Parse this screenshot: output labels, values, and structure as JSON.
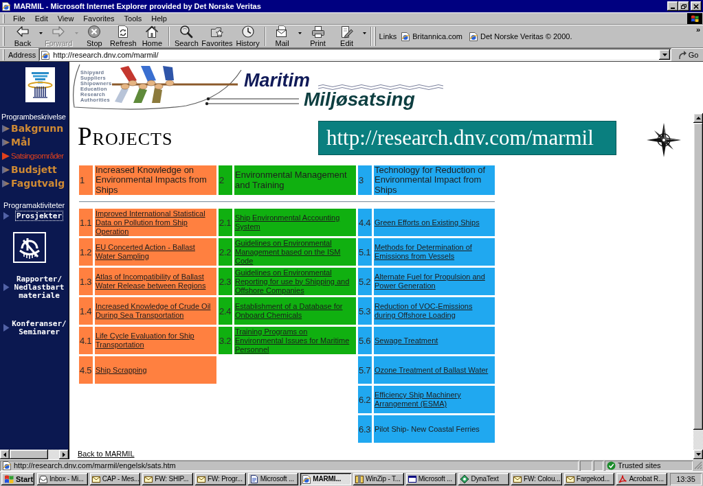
{
  "window": {
    "title": "MARMIL - Microsoft Internet Explorer provided by Det Norske Veritas"
  },
  "menu": [
    "File",
    "Edit",
    "View",
    "Favorites",
    "Tools",
    "Help"
  ],
  "toolbar": {
    "groups": [
      {
        "buttons": [
          {
            "kind": "back",
            "label": "Back",
            "disabled": false,
            "dropdown": true
          },
          {
            "kind": "forward",
            "label": "Forward",
            "disabled": true,
            "dropdown": true
          },
          {
            "kind": "stop",
            "label": "Stop",
            "disabled": false,
            "dropdown": false
          },
          {
            "kind": "refresh",
            "label": "Refresh",
            "disabled": false,
            "dropdown": false
          },
          {
            "kind": "home",
            "label": "Home",
            "disabled": false,
            "dropdown": false
          }
        ]
      },
      {
        "buttons": [
          {
            "kind": "search",
            "label": "Search",
            "disabled": false,
            "dropdown": false
          },
          {
            "kind": "favorites",
            "label": "Favorites",
            "disabled": false,
            "dropdown": false
          },
          {
            "kind": "history",
            "label": "History",
            "disabled": false,
            "dropdown": false
          }
        ]
      },
      {
        "buttons": [
          {
            "kind": "mail",
            "label": "Mail",
            "disabled": false,
            "dropdown": true
          },
          {
            "kind": "print",
            "label": "Print",
            "disabled": false,
            "dropdown": false
          },
          {
            "kind": "edit",
            "label": "Edit",
            "disabled": false,
            "dropdown": true
          }
        ]
      }
    ]
  },
  "links_bar": {
    "label": "Links",
    "items": [
      "Britannica.com",
      "Det Norske Veritas © 2000."
    ],
    "more": "»"
  },
  "address_bar": {
    "label": "Address",
    "value": "http://research.dnv.com/marmil/",
    "go": "Go"
  },
  "sidebar": {
    "description": {
      "heading": "Programbeskrivelse",
      "items": [
        {
          "label": "Bakgrunn",
          "selected": false
        },
        {
          "label": "Mål",
          "selected": false
        },
        {
          "label": "Satsingsområder",
          "selected": true
        },
        {
          "label": "Budsjett",
          "selected": false
        },
        {
          "label": "Fagutvalg",
          "selected": false
        }
      ]
    },
    "activities": {
      "heading": "Programaktiviteter",
      "items": [
        {
          "label": "Prosjekter",
          "focused": true
        },
        {
          "label": "Rapporter/ Nedlastbart materiale",
          "focused": false
        },
        {
          "label": "Konferanser/ Seminarer",
          "focused": false
        }
      ]
    }
  },
  "banner": {
    "stakeholders": [
      "Shipyard",
      "Suppliers",
      "Shipowners",
      "Education",
      "Research",
      "Authorities"
    ],
    "title": "Maritim",
    "subtitle": "Miljøsatsing"
  },
  "main": {
    "heading": "PROJECTS",
    "url_banner": "http://research.dnv.com/marmil",
    "groups": [
      {
        "number": "1",
        "title": "Increased Knowledge on Environmental Impacts from Ships",
        "color": "#ff8040",
        "items": [
          {
            "number": "1.1",
            "title": "Improved International Statistical Data on Pollution from Ship Operation",
            "linked": true
          },
          {
            "number": "1.2",
            "title": "EU Concerted Action - Ballast Water Sampling",
            "linked": true
          },
          {
            "number": "1.3",
            "title": "Atlas of Incompatibility of Ballast Water Release between Regions",
            "linked": true
          },
          {
            "number": "1.4",
            "title": "Increased Knowledge of Crude Oil During Sea Transportation",
            "linked": true
          },
          {
            "number": "4.1",
            "title": "Life Cycle Evaluation for Ship Transportation",
            "linked": true
          },
          {
            "number": "4.5",
            "title": "Ship Scrapping",
            "linked": true
          }
        ]
      },
      {
        "number": "2",
        "title": "Environmental Management and Training",
        "color": "#10b010",
        "items": [
          {
            "number": "2.1",
            "title": "Ship Environmental Accounting System",
            "linked": true
          },
          {
            "number": "2.2",
            "title": "Guidelines on Environmental Management based on the ISM Code",
            "linked": true
          },
          {
            "number": "2.3",
            "title": "Guidelines on Environmental Reporting for use by Shipping and Offshore Companies",
            "linked": true
          },
          {
            "number": "2.4",
            "title": "Establishment of a Database for Onboard Chemicals",
            "linked": true
          },
          {
            "number": "3.2",
            "title": "Training Programs on Environmental Issues for Maritime Personnel",
            "linked": true
          }
        ]
      },
      {
        "number": "3",
        "title": "Technology for Reduction of Environmental Impact from Ships",
        "color": "#20a8f0",
        "items": [
          {
            "number": "4.4",
            "title": "Green Efforts on Existing Ships",
            "linked": true
          },
          {
            "number": "5.1",
            "title": "Methods for Determination of Emissions from Vessels",
            "linked": true
          },
          {
            "number": "5.2",
            "title": "Alternate Fuel for Propulsion and Power Generation",
            "linked": true
          },
          {
            "number": "5.3",
            "title": "Reduction of VOC-Emissions during Offshore Loading",
            "linked": true
          },
          {
            "number": "5.6",
            "title": "Sewage Treatment",
            "linked": true
          },
          {
            "number": "5.7",
            "title": "Ozone Treatment of Ballast Water",
            "linked": true
          },
          {
            "number": "6.2",
            "title": "Efficiency Ship Machinery Arrangement (ESMA)",
            "linked": true
          },
          {
            "number": "6.3",
            "title": "Pilot Ship- New Coastal Ferries",
            "linked": false
          }
        ]
      }
    ],
    "back_link": "Back to MARMIL"
  },
  "status_bar": {
    "text": "http://research.dnv.com/marmil/engelsk/sats.htm",
    "zone": "Trusted sites"
  },
  "taskbar": {
    "start": "Start",
    "tasks": [
      {
        "kind": "inbox",
        "label": "Inbox - Mi...",
        "selected": false
      },
      {
        "kind": "mail",
        "label": "CAP - Mes...",
        "selected": false
      },
      {
        "kind": "mail",
        "label": "FW: SHIP...",
        "selected": false
      },
      {
        "kind": "mail",
        "label": "FW: Progr...",
        "selected": false
      },
      {
        "kind": "document",
        "label": "Microsoft ...",
        "selected": false
      },
      {
        "kind": "browser",
        "label": "MARMI...",
        "selected": true
      },
      {
        "kind": "archive",
        "label": "WinZip - T...",
        "selected": false
      },
      {
        "kind": "window",
        "label": "Microsoft ...",
        "selected": false
      },
      {
        "kind": "diamond",
        "label": "DynaText",
        "selected": false
      },
      {
        "kind": "mail",
        "label": "FW: Colou...",
        "selected": false
      },
      {
        "kind": "mail",
        "label": "Fargekod...",
        "selected": false
      },
      {
        "kind": "pdf",
        "label": "Acrobat R...",
        "selected": false
      }
    ],
    "clock": "13:35"
  }
}
